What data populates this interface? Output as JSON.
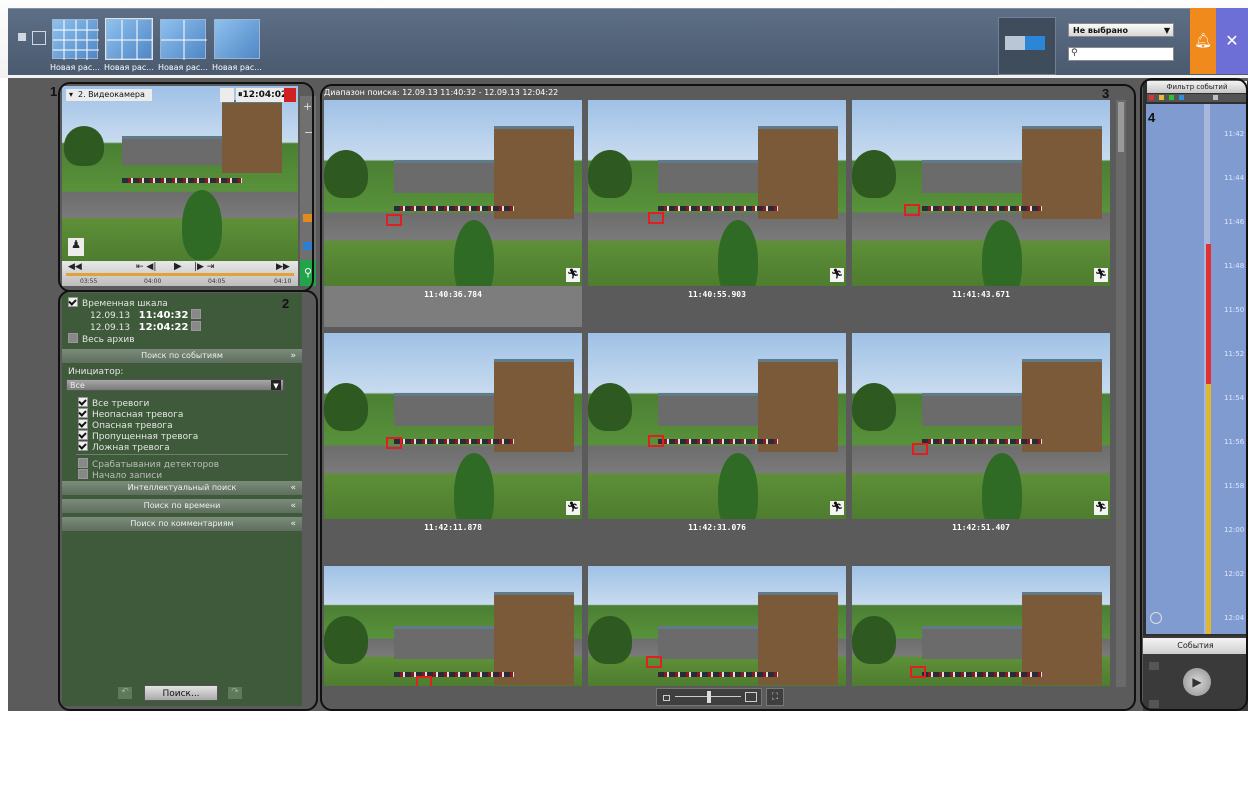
{
  "top": {
    "layouts": [
      {
        "label": "Новая рас..."
      },
      {
        "label": "Новая рас..."
      },
      {
        "label": "Новая рас..."
      },
      {
        "label": "Новая рас..."
      }
    ],
    "dropdown_value": "Не выбрано",
    "search_placeholder": ""
  },
  "panel_numbers": {
    "p1": "1",
    "p2": "2",
    "p3": "3",
    "p4": "4"
  },
  "camera": {
    "name": "2. Видеокамера",
    "time": "12:04:02",
    "timeline_ticks": [
      "03:55",
      "04:00",
      "04:05",
      "04:10"
    ]
  },
  "search_panel": {
    "timescale_label": "Временная шкала",
    "from_date": "12.09.13",
    "from_time": "11:40:32",
    "to_date": "12.09.13",
    "to_time": "12:04:22",
    "whole_archive": "Весь архив",
    "event_search": "Поиск по событиям",
    "initiator_label": "Инициатор:",
    "initiator_value": "Все",
    "alarm_items": [
      {
        "label": "Все тревоги",
        "checked": true
      },
      {
        "label": "Неопасная тревога",
        "checked": true
      },
      {
        "label": "Опасная тревога",
        "checked": true
      },
      {
        "label": "Пропущенная тревога",
        "checked": true
      },
      {
        "label": "Ложная тревога",
        "checked": true
      },
      {
        "label": "Срабатывания детекторов",
        "checked": false
      },
      {
        "label": "Начало записи",
        "checked": false
      }
    ],
    "sections": [
      "Интеллектуальный поиск",
      "Поиск по времени",
      "Поиск по комментариям"
    ],
    "search_button": "Поиск..."
  },
  "results": {
    "range_label": "Диапазон поиска:  12.09.13 11:40:32 - 12.09.13 12:04:22",
    "timestamps": [
      "11:40:36.784",
      "11:40:55.903",
      "11:41:43.671",
      "11:42:11.878",
      "11:42:31.076",
      "11:42:51.407",
      "",
      "",
      ""
    ]
  },
  "events_panel": {
    "filter_label": "Фильтр событий",
    "ticks": [
      "11:42",
      "11:44",
      "11:46",
      "11:48",
      "11:50",
      "11:52",
      "11:54",
      "11:56",
      "11:58",
      "12:00",
      "12:02",
      "12:04"
    ],
    "events_tab": "События"
  }
}
